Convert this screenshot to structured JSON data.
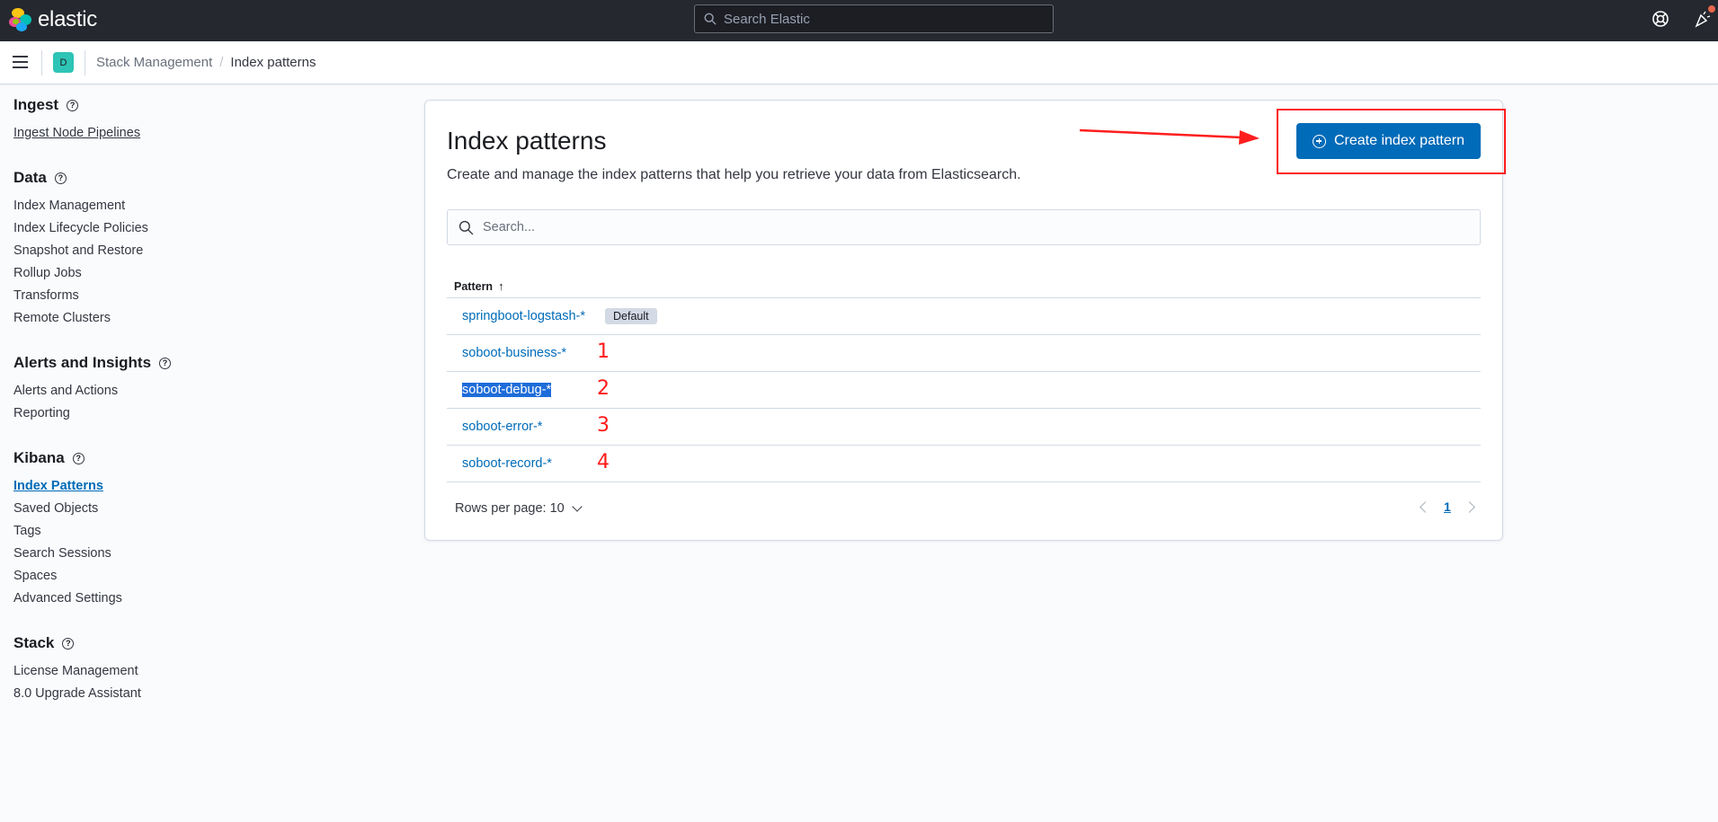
{
  "header": {
    "logo_text": "elastic",
    "search_placeholder": "Search Elastic"
  },
  "subbar": {
    "space_initial": "D",
    "breadcrumbs": [
      "Stack Management",
      "Index patterns"
    ],
    "separator": "/"
  },
  "sidebar": {
    "groups": [
      {
        "title": "Ingest",
        "items": [
          "Ingest Node Pipelines"
        ]
      },
      {
        "title": "Data",
        "items": [
          "Index Management",
          "Index Lifecycle Policies",
          "Snapshot and Restore",
          "Rollup Jobs",
          "Transforms",
          "Remote Clusters"
        ]
      },
      {
        "title": "Alerts and Insights",
        "items": [
          "Alerts and Actions",
          "Reporting"
        ]
      },
      {
        "title": "Kibana",
        "items": [
          "Index Patterns",
          "Saved Objects",
          "Tags",
          "Search Sessions",
          "Spaces",
          "Advanced Settings"
        ]
      },
      {
        "title": "Stack",
        "items": [
          "License Management",
          "8.0 Upgrade Assistant"
        ]
      }
    ],
    "active_item": "Index Patterns"
  },
  "main": {
    "title": "Index patterns",
    "description": "Create and manage the index patterns that help you retrieve your data from Elasticsearch.",
    "create_button_label": "Create index pattern",
    "search_placeholder": "Search...",
    "column_header": "Pattern",
    "sort_glyph": "↑",
    "rows": [
      {
        "pattern": "springboot-logstash-*",
        "badge": "Default",
        "annotation": ""
      },
      {
        "pattern": "soboot-business-*",
        "badge": "",
        "annotation": "1"
      },
      {
        "pattern": "soboot-debug-*",
        "badge": "",
        "annotation": "2",
        "selected": true
      },
      {
        "pattern": "soboot-error-*",
        "badge": "",
        "annotation": "3"
      },
      {
        "pattern": "soboot-record-*",
        "badge": "",
        "annotation": "4"
      }
    ],
    "rows_per_page_label": "Rows per page: 10",
    "current_page": "1"
  },
  "colors": {
    "header_bg": "#25282f",
    "primary": "#006bb8",
    "annotation_red": "#ff1e1e",
    "space_avatar": "#2ec4b6"
  }
}
